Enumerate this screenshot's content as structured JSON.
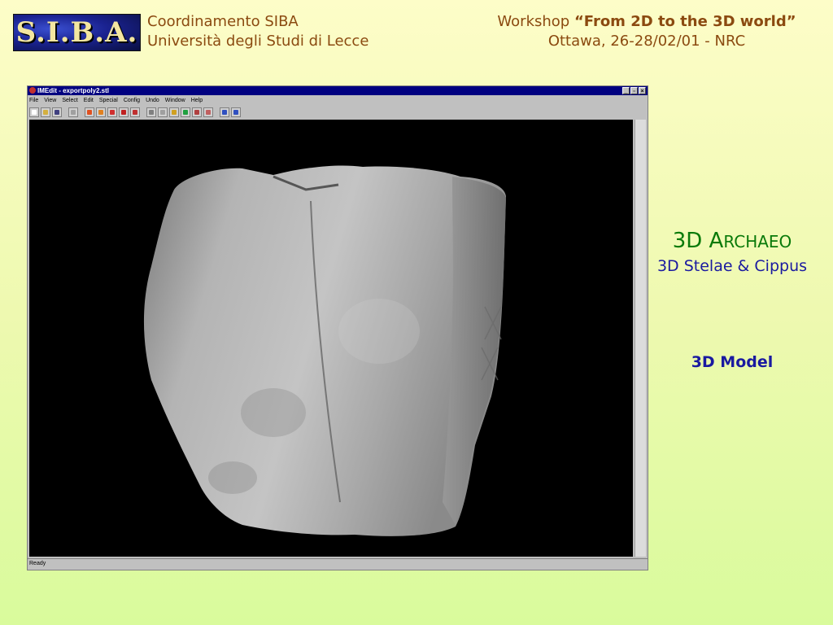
{
  "header": {
    "logo_text": "S.I.B.A.",
    "left_line1": "Coordinamento SIBA",
    "left_line2": "Università degli Studi di Lecce",
    "right_prefix": "Workshop ",
    "right_quote_open": "“",
    "right_title": "From 2D to the 3D world",
    "right_quote_close": "”",
    "right_line2": "Ottawa, 26-28/02/01 - NRC"
  },
  "app": {
    "title": "IMEdit - exportpoly2.stl",
    "menu": [
      "File",
      "View",
      "Select",
      "Edit",
      "Special",
      "Config",
      "Undo",
      "Window",
      "Help"
    ],
    "toolbar_icons": [
      {
        "name": "new-file-icon",
        "color": "#ffffff"
      },
      {
        "name": "open-folder-icon",
        "color": "#d4b040"
      },
      {
        "name": "save-disk-icon",
        "color": "#404080"
      },
      {
        "name": "select-icon",
        "color": "#a0a0a0"
      },
      {
        "name": "pencil-icon",
        "color": "#e05020"
      },
      {
        "name": "paint-icon",
        "color": "#e08020"
      },
      {
        "name": "color-icon",
        "color": "#d03030"
      },
      {
        "name": "red-blob-icon",
        "color": "#c02020"
      },
      {
        "name": "red-curve-icon",
        "color": "#c03030"
      },
      {
        "name": "rotate-icon",
        "color": "#808080"
      },
      {
        "name": "open-icon",
        "color": "#a0a0a0"
      },
      {
        "name": "down-arrow-icon",
        "color": "#d0a020"
      },
      {
        "name": "flag-icon",
        "color": "#20a040"
      },
      {
        "name": "move-icon",
        "color": "#b04040"
      },
      {
        "name": "tool-icon",
        "color": "#c06060"
      },
      {
        "name": "undo-icon",
        "color": "#3050c0"
      },
      {
        "name": "redo-icon",
        "color": "#3050c0"
      }
    ],
    "status": "Ready"
  },
  "captions": {
    "main_first": "3D A",
    "main_rest": "RCHAEO",
    "sub": "3D Stelae & Cippus",
    "model": "3D Model"
  },
  "colors": {
    "header_text": "#8b4a10",
    "caption_green": "#0a7a0a",
    "caption_blue": "#1a1aa0",
    "titlebar": "#000080"
  }
}
